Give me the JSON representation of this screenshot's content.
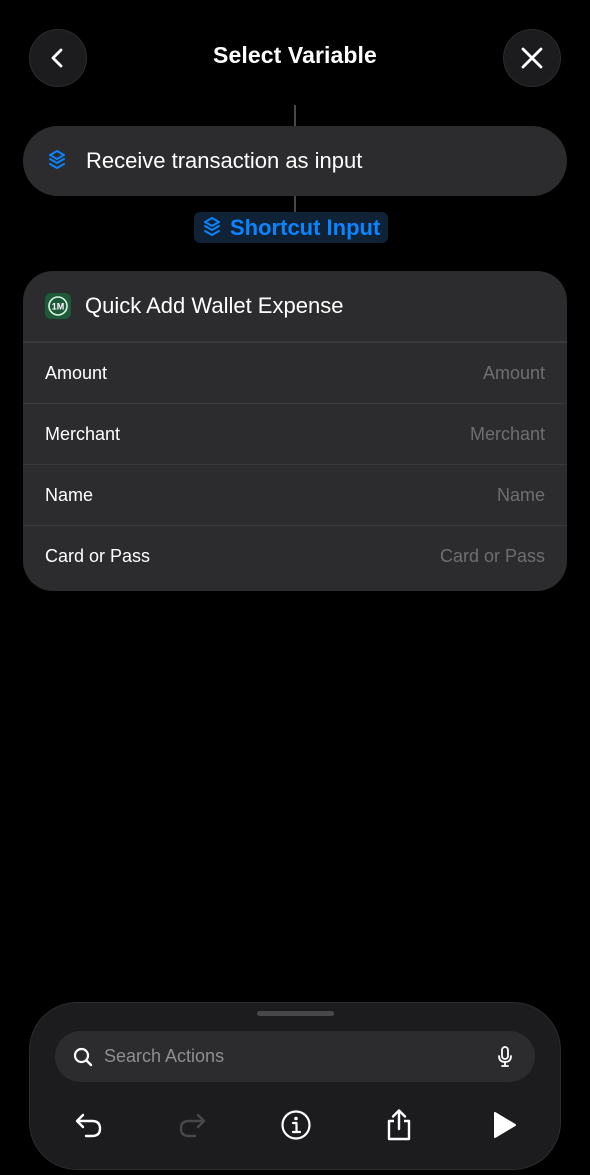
{
  "header": {
    "title": "Select Variable",
    "back_icon": "chevron-left-icon",
    "close_icon": "close-icon"
  },
  "previous_action": {
    "label": "Receive transaction as input",
    "icon": "shortcut-stack-icon"
  },
  "variable_token": {
    "label": "Shortcut Input",
    "icon": "shortcut-stack-icon"
  },
  "action": {
    "title": "Quick Add Wallet Expense",
    "app_icon": "1m-app-icon",
    "app_icon_text": "1M",
    "params": [
      {
        "label": "Amount",
        "placeholder": "Amount"
      },
      {
        "label": "Merchant",
        "placeholder": "Merchant"
      },
      {
        "label": "Name",
        "placeholder": "Name"
      },
      {
        "label": "Card or Pass",
        "placeholder": "Card or Pass"
      }
    ]
  },
  "bottom_panel": {
    "search_placeholder": "Search Actions",
    "search_value": "",
    "toolbar": [
      "undo-icon",
      "redo-icon",
      "info-icon",
      "share-icon",
      "play-icon"
    ]
  },
  "colors": {
    "accent": "#0a84ff",
    "background": "#000000",
    "card": "#2c2c2e",
    "secondary_text": "#6e6e73"
  }
}
